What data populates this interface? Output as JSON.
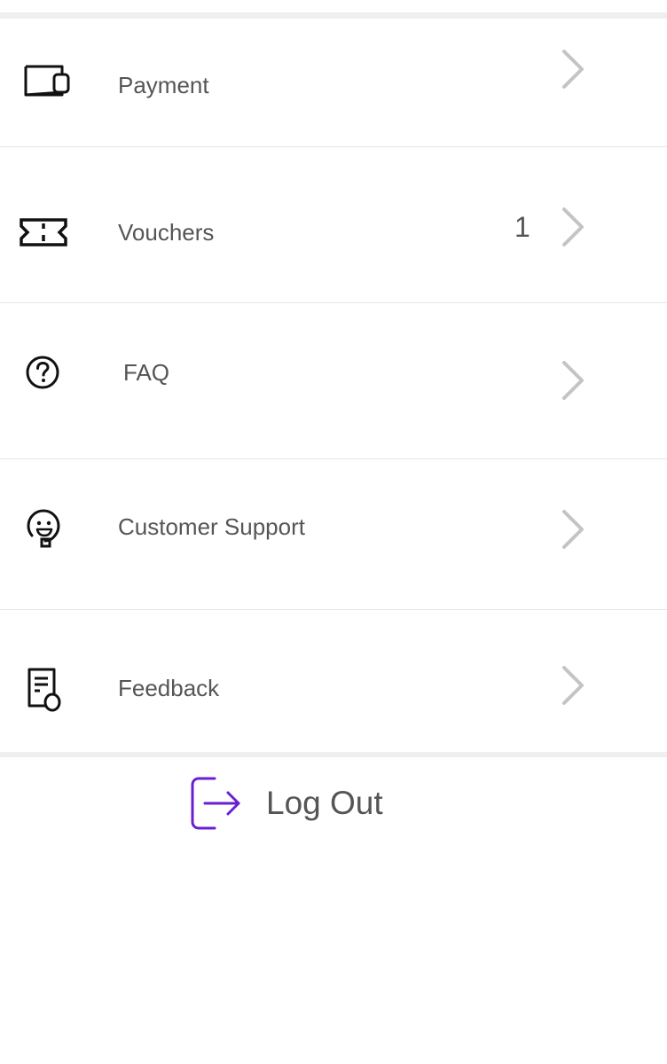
{
  "menu": {
    "items": [
      {
        "label": "Payment",
        "icon": "wallet-icon",
        "badge": ""
      },
      {
        "label": "Vouchers",
        "icon": "ticket-icon",
        "badge": "1"
      },
      {
        "label": "FAQ",
        "icon": "question-circle-icon",
        "badge": ""
      },
      {
        "label": "Customer Support",
        "icon": "support-agent-icon",
        "badge": ""
      },
      {
        "label": "Feedback",
        "icon": "feedback-document-icon",
        "badge": ""
      }
    ]
  },
  "logout": {
    "label": "Log Out",
    "icon": "logout-icon",
    "accent_color": "#6a1fd1"
  },
  "colors": {
    "text": "#555555",
    "chevron": "#c4c4c4",
    "divider": "#e6e6e6",
    "icon": "#111111"
  }
}
